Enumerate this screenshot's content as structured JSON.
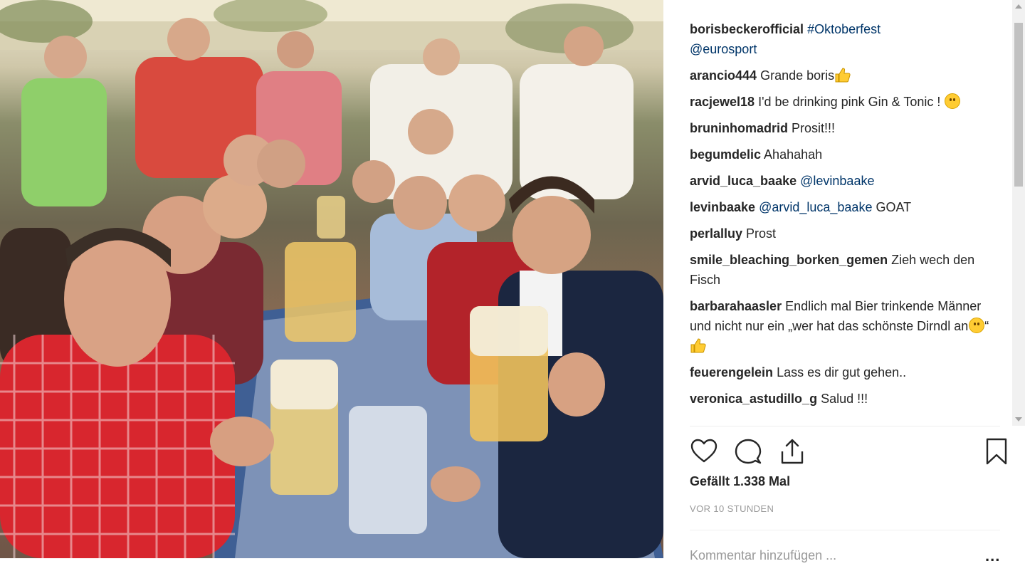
{
  "post": {
    "author": "borisbeckerofficial",
    "caption_tags": [
      "#Oktoberfest",
      "@eurosport"
    ],
    "image_alt": "Oktoberfest group photo"
  },
  "comments": [
    {
      "user": "arancio444",
      "text": "Grande boris",
      "emoji": "thumbs-up"
    },
    {
      "user": "racjewel18",
      "text": "I'd be drinking pink Gin & Tonic !",
      "emoji": "smiley"
    },
    {
      "user": "bruninhomadrid",
      "text": "Prosit!!!"
    },
    {
      "user": "begumdelic",
      "text": "Ahahahah"
    },
    {
      "user": "arvid_luca_baake",
      "mention": "@levinbaake",
      "text": ""
    },
    {
      "user": "levinbaake",
      "mention": "@arvid_luca_baake",
      "text": "GOAT"
    },
    {
      "user": "perlalluy",
      "text": "Prost"
    },
    {
      "user": "smile_bleaching_borken_gemen",
      "text": "Zieh wech den Fisch"
    },
    {
      "user": "barbarahaasler",
      "text": "Endlich mal Bier trinkende Männer und nicht nur ein „wer hat das schönste Dirndl an",
      "text_end": "“",
      "emoji": "smiley+thumbs-up"
    },
    {
      "user": "feuerengelein",
      "text": "Lass es dir gut gehen.."
    },
    {
      "user": "veronica_astudillo_g",
      "text": "Salud !!!"
    }
  ],
  "actions": {
    "like_icon": "heart-icon",
    "comment_icon": "comment-bubble-icon",
    "share_icon": "share-icon",
    "save_icon": "bookmark-icon"
  },
  "likes_text": "Gefällt 1.338 Mal",
  "timestamp": "VOR 10 STUNDEN",
  "comment_input": {
    "placeholder": "Kommentar hinzufügen ..."
  },
  "more_label": "...",
  "colors": {
    "link": "#003569",
    "text": "#262626",
    "muted": "#999999"
  }
}
